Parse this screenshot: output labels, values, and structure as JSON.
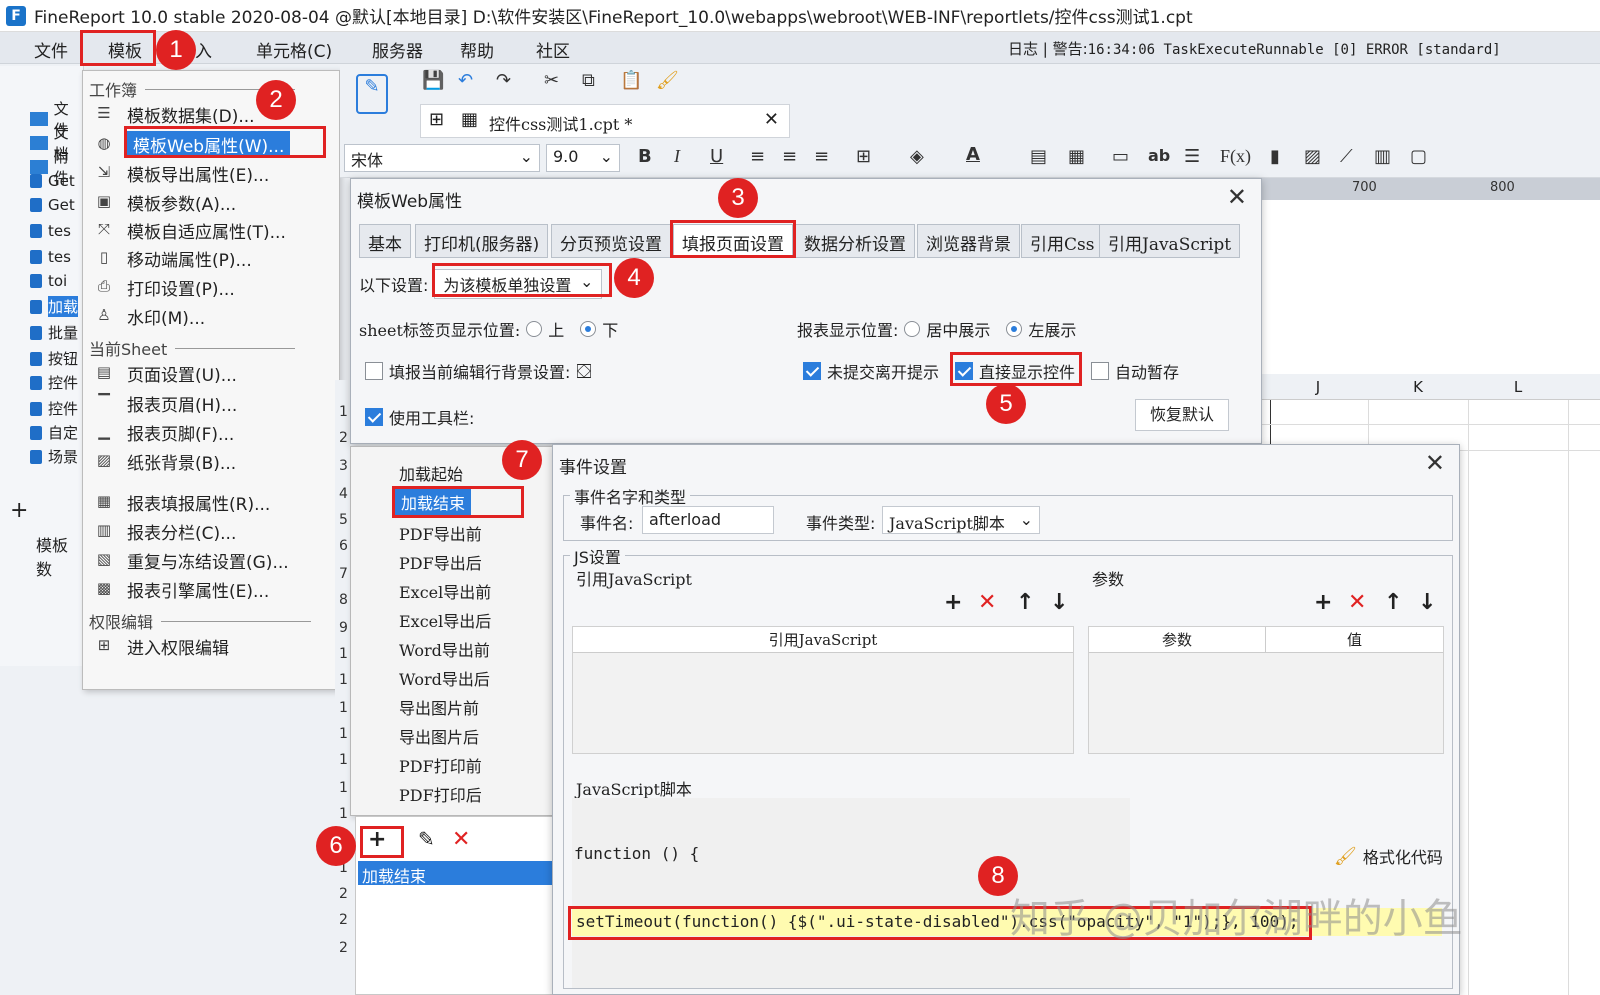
{
  "titlebar": {
    "title": "FineReport 10.0 stable 2020-08-04 @默认[本地目录]     D:\\软件安装区\\FineReport_10.0\\webapps\\webroot\\WEB-INF\\reportlets/控件css测试1.cpt"
  },
  "menubar": {
    "items": [
      "文件",
      "模板",
      "插入",
      "单元格(C)",
      "服务器",
      "帮助",
      "社区"
    ],
    "log_label": "日志",
    "warn_label": "警告:",
    "log_text": "16:34:06 TaskExecuteRunnable [0] ERROR [standard]"
  },
  "tree": {
    "items": [
      "文件",
      "文档",
      "附件",
      "Get",
      "Get",
      "tes",
      "tes",
      "toi",
      "加载",
      "批量",
      "按钮",
      "控件",
      "控件",
      "自定",
      "场景"
    ],
    "bottom_label": "模板数"
  },
  "template_menu": {
    "section_workbook": "工作簿",
    "section_sheet": "当前Sheet",
    "section_permission": "权限编辑",
    "workbook_items": [
      "模板数据集(D)...",
      "模板Web属性(W)...",
      "模板导出属性(E)...",
      "模板参数(A)...",
      "模板自适应属性(T)...",
      "移动端属性(P)...",
      "打印设置(P)...",
      "水印(M)..."
    ],
    "sheet_items": [
      "页面设置(U)...",
      "报表页眉(H)...",
      "报表页脚(F)...",
      "纸张背景(B)...",
      "报表填报属性(R)...",
      "报表分栏(C)...",
      "重复与冻结设置(G)...",
      "报表引擎属性(E)..."
    ],
    "permission_items": [
      "进入权限编辑"
    ]
  },
  "editor": {
    "tab_label": "控件css测试1.cpt *",
    "font_name": "宋体",
    "font_size": "9.0",
    "ruler_marks": [
      "700",
      "800"
    ],
    "columns": [
      "J",
      "K",
      "L"
    ],
    "row_numbers": [
      "1",
      "2",
      "3",
      "4",
      "5",
      "6",
      "7",
      "8",
      "9",
      "1",
      "1",
      "1",
      "1",
      "1",
      "1",
      "1",
      "1",
      "1",
      "2",
      "2",
      "2"
    ]
  },
  "web_dialog": {
    "title": "模板Web属性",
    "tabs": [
      "基本",
      "打印机(服务器)",
      "分页预览设置",
      "填报页面设置",
      "数据分析设置",
      "浏览器背景",
      "引用Css",
      "引用JavaScript"
    ],
    "settings_label": "以下设置:",
    "settings_value": "为该模板单独设置",
    "sheet_pos_label": "sheet标签页显示位置:",
    "sheet_pos_top": "上",
    "sheet_pos_bottom": "下",
    "report_pos_label": "报表显示位置:",
    "report_pos_center": "居中展示",
    "report_pos_left": "左展示",
    "fill_bg_label": "填报当前编辑行背景设置:",
    "unsubmitted_label": "未提交离开提示",
    "show_widget_label": "直接显示控件",
    "autosave_label": "自动暂存",
    "use_toolbar_label": "使用工具栏:",
    "restore_label": "恢复默认"
  },
  "event_list": {
    "items": [
      "加载起始",
      "加载结束",
      "PDF导出前",
      "PDF导出后",
      "Excel导出前",
      "Excel导出后",
      "Word导出前",
      "Word导出后",
      "导出图片前",
      "导出图片后",
      "PDF打印前",
      "PDF打印后"
    ],
    "selected_event": "加载结束"
  },
  "event_dialog": {
    "title": "事件设置",
    "group_name_type": "事件名字和类型",
    "event_name_label": "事件名:",
    "event_name_value": "afterload",
    "event_type_label": "事件类型:",
    "event_type_value": "JavaScript脚本",
    "group_js": "JS设置",
    "ref_js_label": "引用JavaScript",
    "params_label": "参数",
    "ref_js_header": "引用JavaScript",
    "param_header": "参数",
    "value_header": "值",
    "script_label": "JavaScript脚本",
    "code_line1": "function () {",
    "code_line2": "setTimeout(function() {$(\".ui-state-disabled\").css(\"opacity\", \"1\");}, 100);",
    "format_code_label": "格式化代码"
  },
  "badges": [
    "1",
    "2",
    "3",
    "4",
    "5",
    "6",
    "7",
    "8"
  ],
  "watermark": "知乎 @贝加尔湖畔的小鱼",
  "colors": {
    "highlight": "#e02222",
    "selection": "#2b7ddc"
  }
}
